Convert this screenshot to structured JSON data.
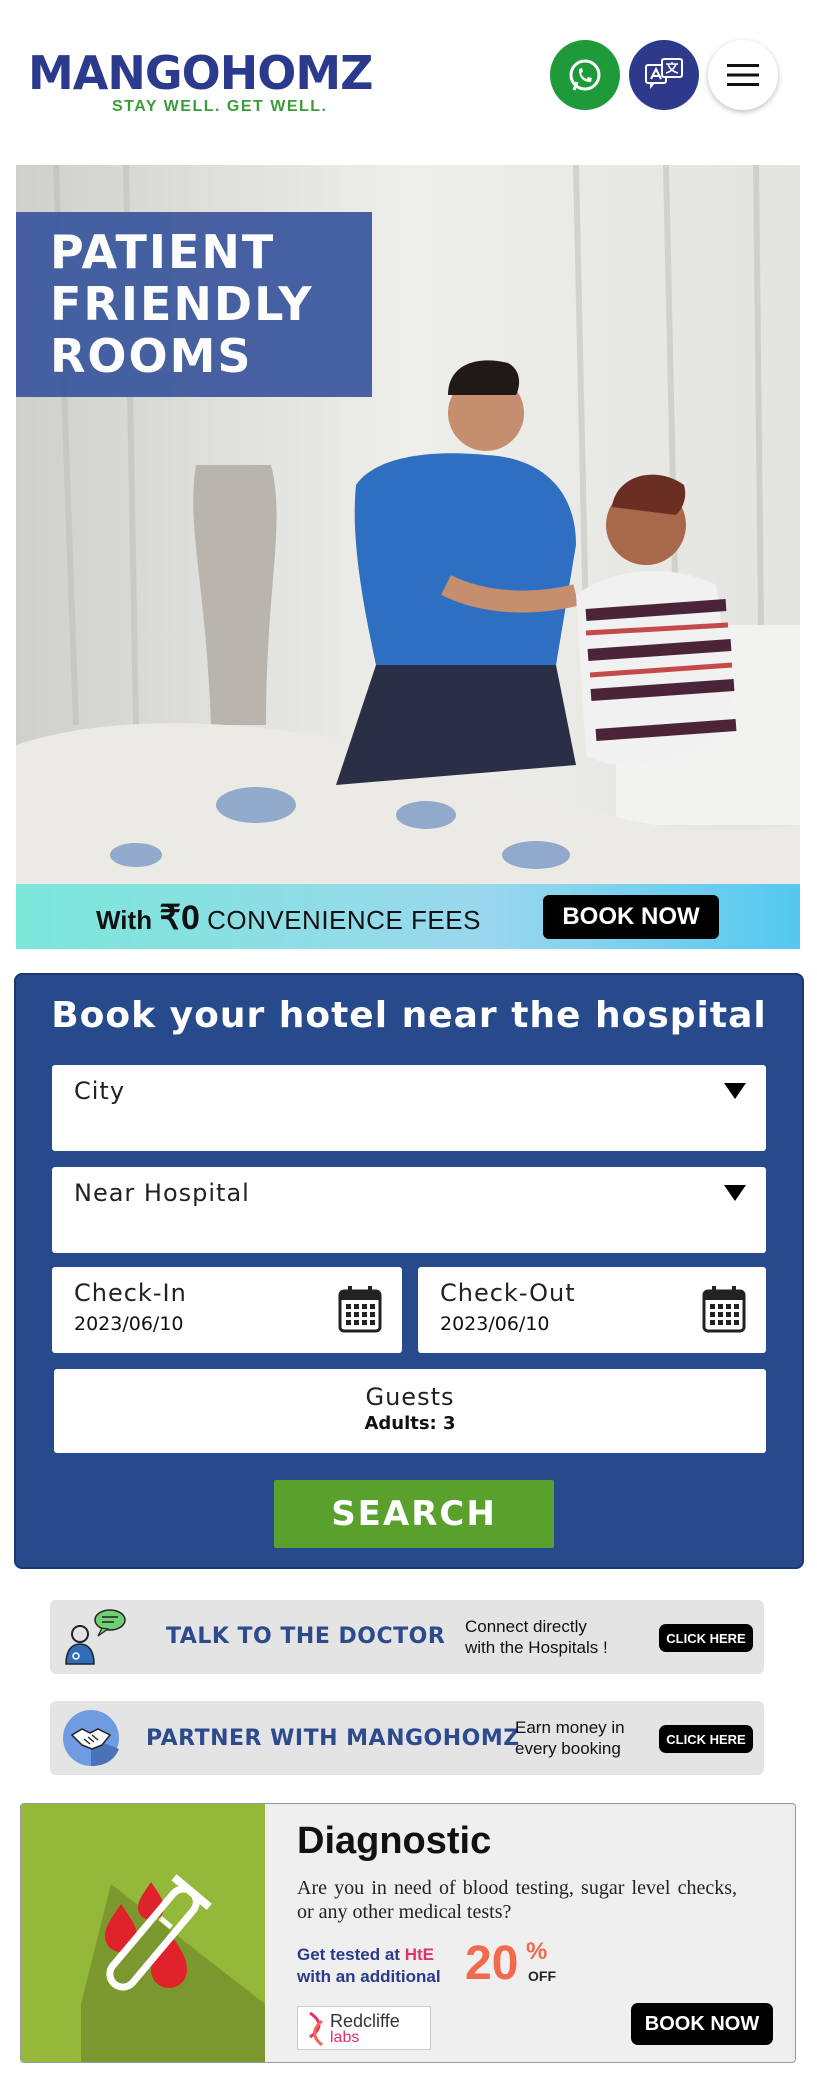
{
  "header": {
    "logo_text": "MANGOHOMZ",
    "logo_tagline": "STAY WELL. GET WELL.",
    "icons": [
      "whatsapp-icon",
      "translate-icon",
      "hamburger-menu-icon"
    ]
  },
  "hero": {
    "title_lines": [
      "PATIENT",
      "FRIENDLY",
      "ROOMS"
    ],
    "strip_prefix": "With",
    "strip_amount": "₹0",
    "strip_suffix": "CONVENIENCE FEES",
    "book_now": "BOOK NOW"
  },
  "booking": {
    "heading": "Book your hotel near the hospital",
    "city_label": "City",
    "hospital_label": "Near Hospital",
    "checkin_label": "Check-In",
    "checkin_value": "2023/06/10",
    "checkout_label": "Check-Out",
    "checkout_value": "2023/06/10",
    "guests_label": "Guests",
    "guests_value": "Adults: 3",
    "search_label": "SEARCH"
  },
  "promos": [
    {
      "title": "TALK TO THE DOCTOR",
      "desc_line1": "Connect directly",
      "desc_line2": "with the Hospitals !",
      "button": "CLICK HERE"
    },
    {
      "title": "PARTNER WITH MANGOHOMZ",
      "desc_line1": "Earn money in",
      "desc_line2": "every booking",
      "button": "CLICK HERE"
    }
  ],
  "diagnostic": {
    "title": "Diagnostic",
    "description": "Are you in need of blood testing, sugar level checks, or any other medical tests?",
    "tested_prefix": "Get tested at",
    "tested_brand": "HtE",
    "tested_suffix": "with an additional",
    "discount_value": "20",
    "discount_symbol": "%",
    "discount_off": "OFF",
    "partner_name": "Redcliffe",
    "partner_sub": "labs",
    "book_now": "BOOK NOW"
  },
  "colors": {
    "brand_blue": "#2c3a8e",
    "brand_green": "#3a9d3a",
    "whatsapp_green": "#1f9a3a",
    "booking_bg": "#264a8c",
    "search_green": "#5aa02c",
    "discount_orange": "#f26a4e"
  }
}
